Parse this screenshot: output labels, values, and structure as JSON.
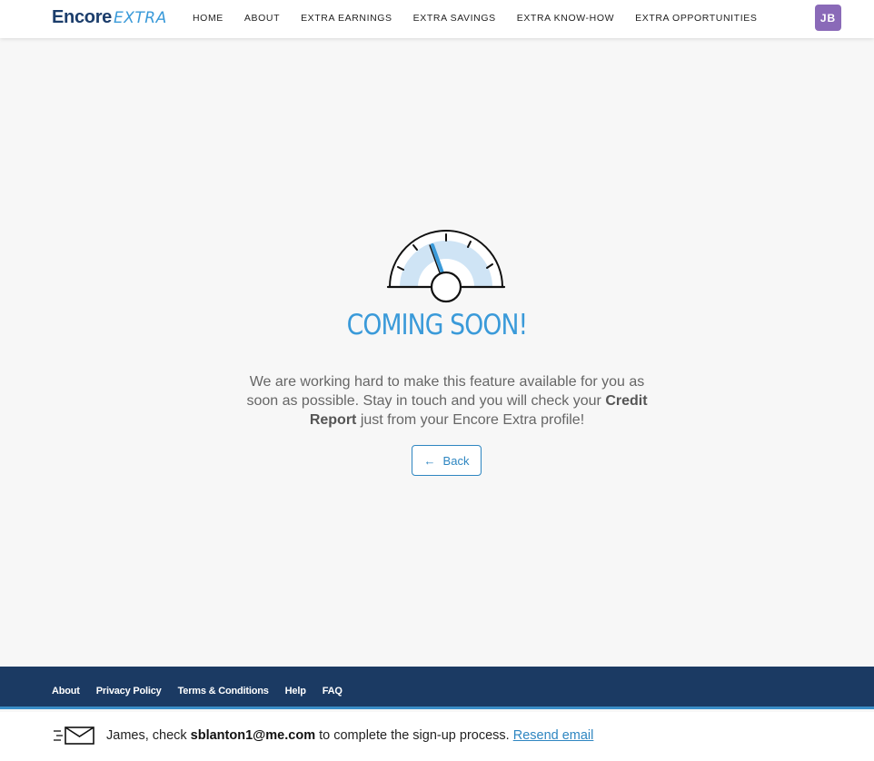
{
  "brand": {
    "name_main": "Encore",
    "name_accent": "EXTRA"
  },
  "nav": {
    "items": [
      "HOME",
      "ABOUT",
      "EXTRA EARNINGS",
      "EXTRA SAVINGS",
      "EXTRA KNOW-HOW",
      "EXTRA OPPORTUNITIES"
    ]
  },
  "user": {
    "initials": "JB"
  },
  "main": {
    "heading": "COMING SOON!",
    "message_part1": "We are working hard to make this feature available for you as soon as possible. Stay in touch and you will check your ",
    "message_bold": "Credit Report",
    "message_part2": " just from your Encore Extra profile!",
    "back_label": "Back"
  },
  "footer": {
    "links": [
      "About",
      "Privacy Policy",
      "Terms & Conditions",
      "Help",
      "FAQ"
    ]
  },
  "notice": {
    "prefix": "James, check ",
    "email": "sblanton1@me.com",
    "suffix": " to complete the sign-up process. ",
    "resend_label": "Resend email"
  },
  "icons": {
    "gauge": "speedometer-icon",
    "back": "arrow-left-icon",
    "mail": "envelope-icon"
  },
  "colors": {
    "brand_navy": "#1b3d6b",
    "accent_blue": "#3a9ad9",
    "avatar": "#8a6ab8",
    "footer": "#1b3a63"
  }
}
